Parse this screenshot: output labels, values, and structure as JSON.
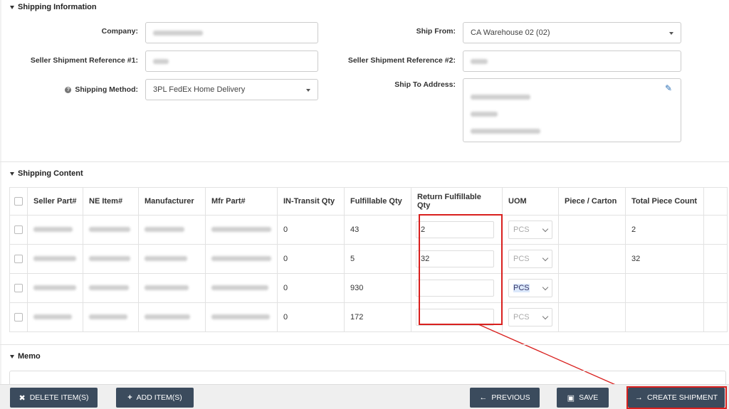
{
  "sections": {
    "shipping_info": "Shipping Information",
    "shipping_content": "Shipping Content",
    "memo": "Memo"
  },
  "form": {
    "company_label": "Company:",
    "ref1_label": "Seller Shipment Reference #1:",
    "method_label": "Shipping Method:",
    "method_value": "3PL FedEx Home Delivery",
    "ship_from_label": "Ship From:",
    "ship_from_value": "CA Warehouse 02 (02)",
    "ref2_label": "Seller Shipment Reference #2:",
    "ship_to_label": "Ship To Address:"
  },
  "table": {
    "headers": [
      "Seller Part#",
      "NE Item#",
      "Manufacturer",
      "Mfr Part#",
      "IN-Transit Qty",
      "Fulfillable Qty",
      "Return Fulfillable Qty",
      "UOM",
      "Piece / Carton",
      "Total Piece Count"
    ],
    "rows": [
      {
        "in_transit": "0",
        "fulfillable": "43",
        "return_fulfillable": "2",
        "uom": "PCS",
        "total": "2"
      },
      {
        "in_transit": "0",
        "fulfillable": "5",
        "return_fulfillable": "32",
        "uom": "PCS",
        "total": "32"
      },
      {
        "in_transit": "0",
        "fulfillable": "930",
        "return_fulfillable": "",
        "uom": "PCS",
        "total": ""
      },
      {
        "in_transit": "0",
        "fulfillable": "172",
        "return_fulfillable": "",
        "uom": "PCS",
        "total": ""
      }
    ]
  },
  "buttons": {
    "delete": "DELETE ITEM(S)",
    "add": "ADD ITEM(S)",
    "previous": "PREVIOUS",
    "save": "SAVE",
    "create": "CREATE SHIPMENT"
  },
  "colors": {
    "button_bg": "#3b4b5d",
    "highlight_red": "#d9201e",
    "link_blue": "#2a6fb5"
  }
}
